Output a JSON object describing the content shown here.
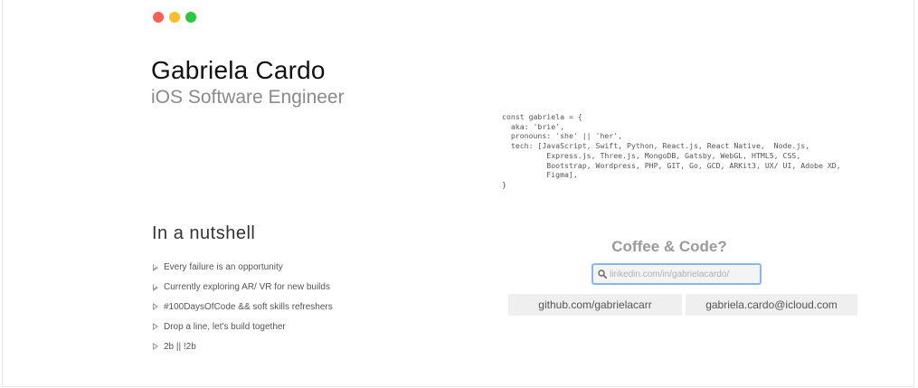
{
  "header": {
    "name": "Gabriela Cardo",
    "role": "iOS Software Engineer"
  },
  "window_controls": [
    "close",
    "minimize",
    "maximize"
  ],
  "code_snippet": "const gabriela = {\n  aka: 'brie',\n  pronouns: 'she' || 'her',\n  tech: [JavaScript, Swift, Python, React.js, React Native,  Node.js,\n          Express.js, Three.js, MongoDB, Gatsby, WebGL, HTML5, CSS,\n          Bootstrap, Wordpress, PHP, GIT, Go, GCD, ARKit3, UX/ UI, Adobe XD,\n          Figma],\n}",
  "nutshell": {
    "title": "In a nutshell",
    "items": [
      "Every failure is an opportunity",
      "Currently exploring AR/ VR for new builds",
      "#100DaysOfCode && soft skills refreshers",
      "Drop a line, let's build together",
      "2b || !2b"
    ]
  },
  "contact": {
    "title": "Coffee & Code?",
    "linkedin_placeholder": "linkedin.com/in/gabrielacardo/",
    "github_label": "github.com/gabrielacarr",
    "email_label": "gabriela.cardo@icloud.com"
  },
  "colors": {
    "close": "#ff5f57",
    "minimize": "#febc2e",
    "maximize": "#28c840",
    "focus_ring": "#8ab4f0"
  }
}
